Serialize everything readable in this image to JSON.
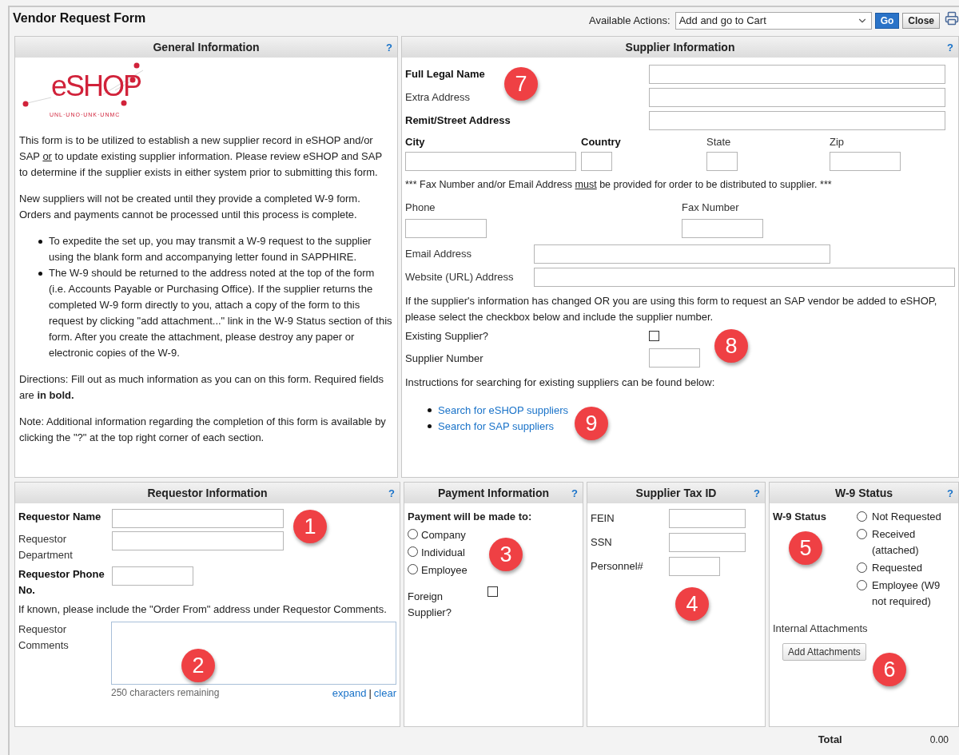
{
  "header": {
    "title": "Vendor Request Form",
    "actions_label": "Available Actions:",
    "action_value": "Add and go to Cart",
    "buttons": [
      {
        "label": "Go",
        "kind": "primary"
      },
      {
        "label": "Close",
        "kind": "secondary"
      }
    ]
  },
  "general": {
    "title": "General Information",
    "help": "?",
    "logo": {
      "name": "eSHOP",
      "tagline": "UNL·UNO·UNK·UNMC"
    },
    "intro": [
      [
        {
          "text": "This form is to be utilized to establish a new supplier record in eSHOP and/or SAP ",
          "underline": false
        },
        {
          "text": "or",
          "underline": true
        },
        {
          "text": " to update existing supplier information. Please review eSHOP and SAP to determine if the supplier exists in either system prior to submitting this form.",
          "underline": false
        }
      ],
      [
        {
          "text": "New suppliers will not be created until they provide a completed W-9 form. Orders and payments cannot be processed until this process is complete.",
          "underline": false
        }
      ]
    ],
    "bullets": [
      "To expedite the set up, you may transmit a W-9 request to the supplier using the blank form and accompanying letter found in SAPPHIRE.",
      "The W-9 should be returned to the address noted at the top of the form (i.e. Accounts Payable or Purchasing Office). If the supplier returns the completed W-9 form directly to you, attach a copy of the form to this request by clicking \"add attachment...\" link in the W-9 Status section of this form. After you create the attachment, please destroy any paper or electronic copies of the W-9."
    ],
    "outro": [
      "Directions: Fill out as much information as you can on this form. Required fields are **in bold.**",
      "Note: Additional information regarding the completion of this form is available by clicking the \"?\" at the top right corner of each section."
    ]
  },
  "supplier": {
    "title": "Supplier Information",
    "help": "?",
    "name_fields": [
      {
        "label": "Full Legal Name",
        "required": true
      },
      {
        "label": "Extra Address",
        "required": false
      },
      {
        "label": "Remit/Street Address",
        "required": true
      }
    ],
    "location_fields": [
      {
        "label": "City",
        "required": true
      },
      {
        "label": "Country",
        "required": true
      },
      {
        "label": "State",
        "required": false
      },
      {
        "label": "Zip",
        "required": false
      }
    ],
    "notice": [
      {
        "text": "*** Fax Number and/or Email Address ",
        "underline": false
      },
      {
        "text": "must",
        "underline": true
      },
      {
        "text": " be provided for order to be distributed to supplier. ***",
        "underline": false
      }
    ],
    "contact_fields": [
      {
        "label": "Phone",
        "required": false
      },
      {
        "label": "Fax Number",
        "required": false
      }
    ],
    "web_fields": [
      {
        "label": "Email Address",
        "required": false
      },
      {
        "label": "Website (URL) Address",
        "required": false
      }
    ],
    "change_note": "If the supplier's information has changed OR you are using this form to request an SAP vendor be added to eSHOP, please select the checkbox below and include the supplier number.",
    "existing": {
      "label": "Existing Supplier?",
      "checked": false
    },
    "supplier_number": {
      "label": "Supplier Number"
    },
    "search_intro": "Instructions for searching for existing suppliers can be found below:",
    "links": [
      "Search for eSHOP suppliers",
      "Search for SAP suppliers"
    ]
  },
  "requestor": {
    "title": "Requestor Information",
    "help": "?",
    "fields": [
      {
        "label": "Requestor Name",
        "required": true,
        "kind": "wide"
      },
      {
        "label": "Requestor Department",
        "required": false,
        "kind": "wide"
      },
      {
        "label": "Requestor Phone No.",
        "required": true,
        "kind": "short"
      }
    ],
    "note": "If known, please include the \"Order From\" address under Requestor Comments.",
    "comments": {
      "label": "Requestor Comments",
      "counter": "250 characters remaining",
      "links": [
        "expand",
        "clear"
      ],
      "separator": "|"
    }
  },
  "payment": {
    "title": "Payment Information",
    "help": "?",
    "prompt": "Payment will be made to:",
    "options": [
      {
        "label": "Company",
        "selected": false
      },
      {
        "label": "Individual",
        "selected": false
      },
      {
        "label": "Employee",
        "selected": false
      }
    ],
    "foreign": {
      "label": "Foreign Supplier?",
      "checked": false
    }
  },
  "tax": {
    "title": "Supplier Tax ID",
    "help": "?",
    "fields": [
      {
        "label": "FEIN",
        "kind": "wide"
      },
      {
        "label": "SSN",
        "kind": "wide"
      },
      {
        "label": "Personnel#",
        "kind": "short"
      }
    ]
  },
  "w9": {
    "title": "W-9 Status",
    "help": "?",
    "label": "W-9 Status",
    "options": [
      {
        "label": "Not Requested",
        "selected": false
      },
      {
        "label": "Received (attached)",
        "selected": false
      },
      {
        "label": "Requested",
        "selected": false
      },
      {
        "label": "Employee (W9 not required)",
        "selected": false
      }
    ],
    "attachments_label": "Internal Attachments",
    "button": "Add Attachments"
  },
  "total": {
    "label": "Total",
    "value": "0.00"
  },
  "callouts": [
    "1",
    "2",
    "3",
    "4",
    "5",
    "6",
    "7",
    "8",
    "9"
  ]
}
